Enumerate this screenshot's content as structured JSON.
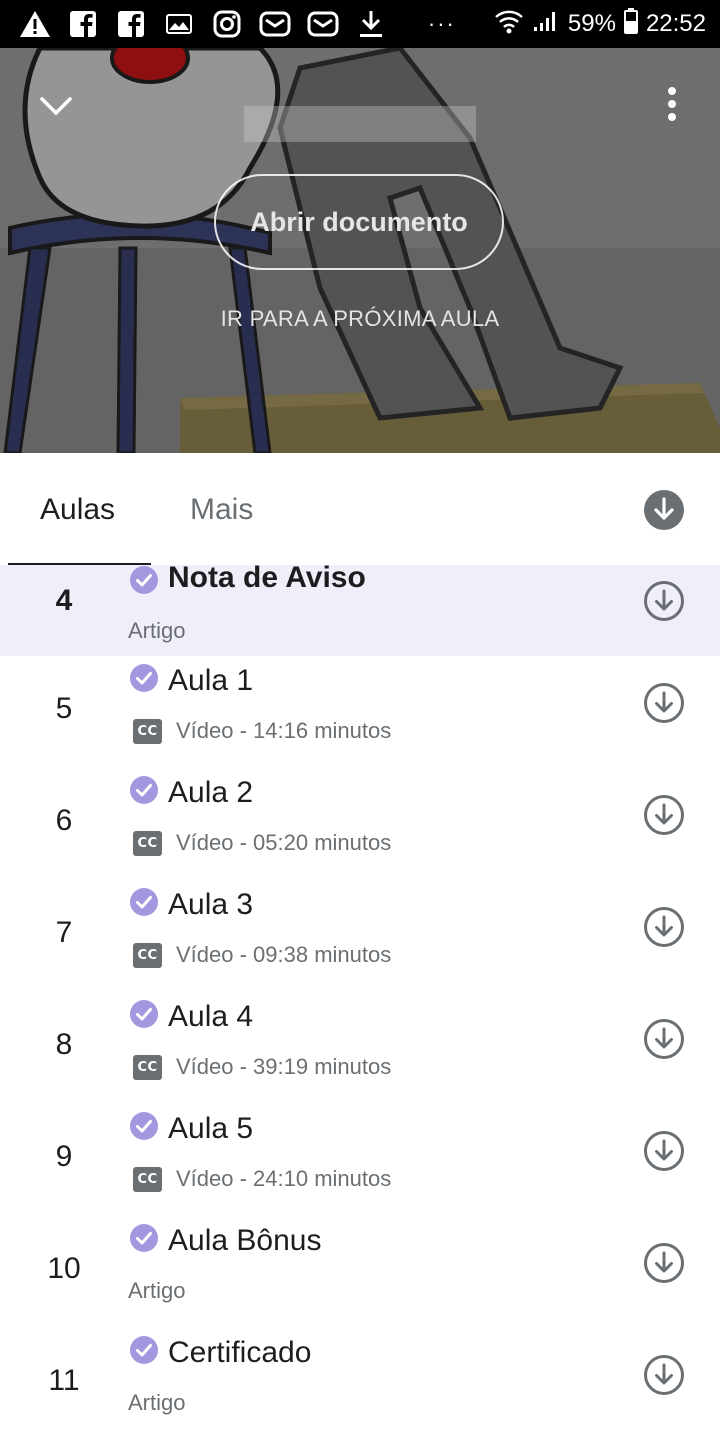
{
  "status_bar": {
    "battery": "59%",
    "time": "22:52",
    "dots": "···",
    "icons_left": [
      "warning-icon",
      "facebook-icon",
      "facebook-icon",
      "image-icon",
      "instagram-icon",
      "mail-icon",
      "mail-icon",
      "download-icon"
    ],
    "icons_right": [
      "wifi-icon",
      "signal-icon",
      "battery-icon"
    ]
  },
  "hero": {
    "open_document_label": "Abrir documento",
    "next_lesson_label": "IR PARA A PRÓXIMA AULA"
  },
  "tabs": [
    {
      "label": "Aulas",
      "selected": true
    },
    {
      "label": "Mais",
      "selected": false
    }
  ],
  "lessons": [
    {
      "number": "4",
      "title": "Nota de Aviso",
      "meta": "Artigo",
      "has_cc": false,
      "active": true,
      "completed": true
    },
    {
      "number": "5",
      "title": "Aula 1",
      "meta": "Vídeo - 14:16 minutos",
      "has_cc": true,
      "active": false,
      "completed": true
    },
    {
      "number": "6",
      "title": "Aula 2",
      "meta": "Vídeo - 05:20 minutos",
      "has_cc": true,
      "active": false,
      "completed": true
    },
    {
      "number": "7",
      "title": "Aula 3",
      "meta": "Vídeo - 09:38 minutos",
      "has_cc": true,
      "active": false,
      "completed": true
    },
    {
      "number": "8",
      "title": "Aula 4",
      "meta": "Vídeo - 39:19 minutos",
      "has_cc": true,
      "active": false,
      "completed": true
    },
    {
      "number": "9",
      "title": "Aula 5",
      "meta": "Vídeo - 24:10 minutos",
      "has_cc": true,
      "active": false,
      "completed": true
    },
    {
      "number": "10",
      "title": "Aula Bônus",
      "meta": "Artigo",
      "has_cc": false,
      "active": false,
      "completed": true
    },
    {
      "number": "11",
      "title": "Certificado",
      "meta": "Artigo",
      "has_cc": false,
      "active": false,
      "completed": true
    }
  ],
  "cc_badge": "CC",
  "colors": {
    "accent_check": "#a596e0",
    "active_row_bg": "#f0eef9",
    "icon_gray": "#6a6f73",
    "text_dark": "#1c1d1f"
  }
}
